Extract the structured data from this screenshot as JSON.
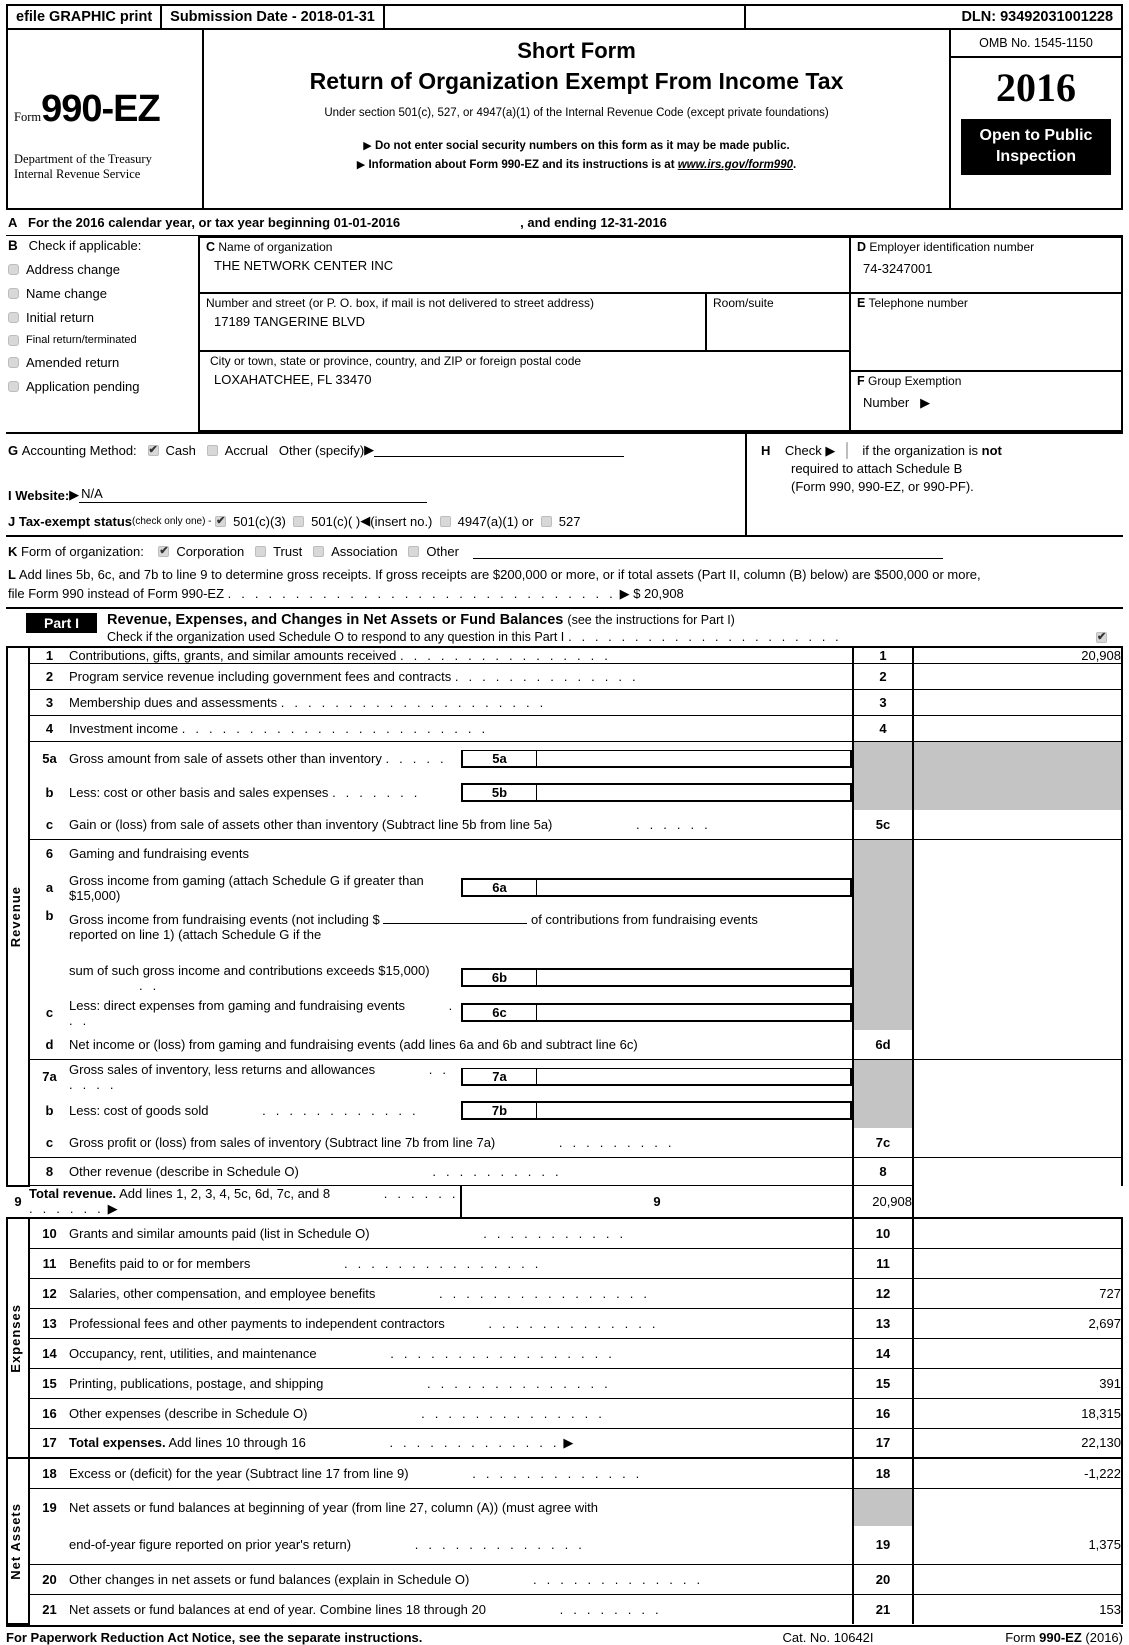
{
  "efile": {
    "graphic_print": "efile GRAPHIC print",
    "submission_date": "Submission Date - 2018-01-31",
    "dln": "DLN: 93492031001228"
  },
  "header": {
    "form_label": "Form",
    "form_number": "990-EZ",
    "dept_line1": "Department of the Treasury",
    "dept_line2": "Internal Revenue Service",
    "short_form": "Short Form",
    "title": "Return of Organization Exempt From Income Tax",
    "subtitle": "Under section 501(c), 527, or 4947(a)(1) of the Internal Revenue Code (except private foundations)",
    "bullet1": "Do not enter social security numbers on this form as it may be made public.",
    "bullet2_pre": "Information about Form 990-EZ and its instructions is at ",
    "bullet2_link": "www.irs.gov/form990",
    "bullet2_post": ".",
    "omb": "OMB No. 1545-1150",
    "year": "2016",
    "open_public": "Open to Public",
    "inspection": "Inspection"
  },
  "section_a": {
    "letter": "A",
    "text_pre": "For the 2016 calendar year, or tax year beginning",
    "begin_date": "01-01-2016",
    "text_mid": ", and ending",
    "end_date": "12-31-2016"
  },
  "section_b": {
    "letter": "B",
    "heading": "Check if applicable:",
    "items": [
      {
        "label": "Address change",
        "checked": false
      },
      {
        "label": "Name change",
        "checked": false
      },
      {
        "label": "Initial return",
        "checked": false
      },
      {
        "label": "Final return/terminated",
        "checked": false
      },
      {
        "label": "Amended return",
        "checked": false
      },
      {
        "label": "Application pending",
        "checked": false
      }
    ]
  },
  "org": {
    "c_letter": "C",
    "c_label": "Name of organization",
    "c_value": "THE NETWORK CENTER INC",
    "street_label": "Number and street (or P. O. box, if mail is not delivered to street address)",
    "street_value": "17189 TANGERINE BLVD",
    "room_label": "Room/suite",
    "room_value": "",
    "city_label": "City or town, state or province, country, and ZIP or foreign postal code",
    "city_value": "LOXAHATCHEE, FL   33470"
  },
  "right_col": {
    "d_letter": "D",
    "d_label": "Employer identification number",
    "d_value": "74-3247001",
    "e_letter": "E",
    "e_label": "Telephone number",
    "e_value": "",
    "f_letter": "F",
    "f_label": "Group Exemption",
    "f_label2": "Number",
    "f_value": ""
  },
  "section_g": {
    "letter": "G",
    "label": "Accounting Method:",
    "cash": "Cash",
    "cash_checked": true,
    "accrual": "Accrual",
    "accrual_checked": false,
    "other": "Other (specify)",
    "other_value": ""
  },
  "section_h": {
    "letter": "H",
    "text1": "Check",
    "checked": false,
    "text2_pre": "if the organization is ",
    "text2_bold": "not",
    "text3": "required to attach Schedule B",
    "text4": "(Form 990, 990-EZ, or 990-PF)."
  },
  "section_i": {
    "letter": "I Website:",
    "value": "N/A"
  },
  "section_j": {
    "letter": "J Tax-exempt status",
    "note": "(check only one) -",
    "opt1": "501(c)(3)",
    "opt1_checked": true,
    "opt2": "501(c)(   )",
    "opt2_checked": false,
    "insert": "(insert no.)",
    "opt3": "4947(a)(1) or",
    "opt3_checked": false,
    "opt4": "527",
    "opt4_checked": false
  },
  "section_k": {
    "letter": "K",
    "label": "Form of organization:",
    "opts": [
      {
        "label": "Corporation",
        "checked": true
      },
      {
        "label": "Trust",
        "checked": false
      },
      {
        "label": "Association",
        "checked": false
      },
      {
        "label": "Other",
        "checked": false
      }
    ],
    "other_value": ""
  },
  "section_l": {
    "letter": "L",
    "line1": "Add lines 5b, 6c, and 7b to line 9 to determine gross receipts. If gross receipts are $200,000 or more, or if total assets (Part II, column (B) below) are $500,000 or more,",
    "line2": "file Form 990 instead of Form 990-EZ",
    "amount": "$ 20,908"
  },
  "part1": {
    "tag": "Part I",
    "title": "Revenue, Expenses, and Changes in Net Assets or Fund Balances",
    "title_note": "(see the instructions for Part I)",
    "schedule_o_text": "Check if the organization used Schedule O to respond to any question in this Part I",
    "schedule_o_checked": true,
    "side_labels": {
      "revenue": "Revenue",
      "expenses": "Expenses",
      "net_assets": "Net Assets"
    },
    "rows": [
      {
        "num": "1",
        "desc": "Contributions, gifts, grants, and similar amounts received",
        "box": "1",
        "amount": "20,908"
      },
      {
        "num": "2",
        "desc": "Program service revenue including government fees and contracts",
        "box": "2",
        "amount": ""
      },
      {
        "num": "3",
        "desc": "Membership dues and assessments",
        "box": "3",
        "amount": ""
      },
      {
        "num": "4",
        "desc": "Investment income",
        "box": "4",
        "amount": ""
      },
      {
        "num": "5a",
        "desc": "Gross amount from sale of assets other than inventory",
        "sub": "5a",
        "sub_amount": ""
      },
      {
        "num": "b",
        "desc": "Less: cost or other basis and sales expenses",
        "sub": "5b",
        "sub_amount": ""
      },
      {
        "num": "c",
        "desc": "Gain or (loss) from sale of assets other than inventory (Subtract line 5b from line 5a)",
        "box": "5c",
        "amount": ""
      },
      {
        "num": "6",
        "desc": "Gaming and fundraising events"
      },
      {
        "num": "a",
        "desc": "Gross income from gaming (attach Schedule G if greater than $15,000)",
        "sub": "6a",
        "sub_amount": ""
      },
      {
        "num": "b",
        "desc": "Gross income from fundraising events (not including $",
        "desc2": "of contributions from fundraising events",
        "desc3": "reported on line 1) (attach Schedule G if the",
        "inline_value": ""
      },
      {
        "num": "",
        "desc": "sum of such gross income and contributions exceeds $15,000)",
        "sub": "6b",
        "sub_amount": ""
      },
      {
        "num": "c",
        "desc": "Less: direct expenses from gaming and fundraising events",
        "sub": "6c",
        "sub_amount": ""
      },
      {
        "num": "d",
        "desc": "Net income or (loss) from gaming and fundraising events (add lines 6a and 6b and subtract line 6c)",
        "box": "6d",
        "amount": ""
      },
      {
        "num": "7a",
        "desc": "Gross sales of inventory, less returns and allowances",
        "sub": "7a",
        "sub_amount": ""
      },
      {
        "num": "b",
        "desc": "Less: cost of goods sold",
        "sub": "7b",
        "sub_amount": ""
      },
      {
        "num": "c",
        "desc": "Gross profit or (loss) from sales of inventory (Subtract line 7b from line 7a)",
        "box": "7c",
        "amount": ""
      },
      {
        "num": "8",
        "desc": "Other revenue (describe in Schedule O)",
        "box": "8",
        "amount": ""
      },
      {
        "num": "9",
        "desc_bold": "Total revenue.",
        "desc": " Add lines 1, 2, 3, 4, 5c, 6d, 7c, and 8",
        "box": "9",
        "amount": "20,908"
      },
      {
        "num": "10",
        "desc": "Grants and similar amounts paid (list in Schedule O)",
        "box": "10",
        "amount": ""
      },
      {
        "num": "11",
        "desc": "Benefits paid to or for members",
        "box": "11",
        "amount": ""
      },
      {
        "num": "12",
        "desc": "Salaries, other compensation, and employee benefits",
        "box": "12",
        "amount": "727"
      },
      {
        "num": "13",
        "desc": "Professional fees and other payments to independent contractors",
        "box": "13",
        "amount": "2,697"
      },
      {
        "num": "14",
        "desc": "Occupancy, rent, utilities, and maintenance",
        "box": "14",
        "amount": ""
      },
      {
        "num": "15",
        "desc": "Printing, publications, postage, and shipping",
        "box": "15",
        "amount": "391"
      },
      {
        "num": "16",
        "desc": "Other expenses (describe in Schedule O)",
        "box": "16",
        "amount": "18,315"
      },
      {
        "num": "17",
        "desc_bold": "Total expenses.",
        "desc": " Add lines 10 through 16",
        "box": "17",
        "amount": "22,130"
      },
      {
        "num": "18",
        "desc": "Excess or (deficit) for the year (Subtract line 17 from line 9)",
        "box": "18",
        "amount": "-1,222"
      },
      {
        "num": "19",
        "desc": "Net assets or fund balances at beginning of year (from line 27, column (A)) (must agree with"
      },
      {
        "num": "",
        "desc": "end-of-year figure reported on prior year's return)",
        "box": "19",
        "amount": "1,375"
      },
      {
        "num": "20",
        "desc": "Other changes in net assets or fund balances (explain in Schedule O)",
        "box": "20",
        "amount": ""
      },
      {
        "num": "21",
        "desc": "Net assets or fund balances at end of year. Combine lines 18 through 20",
        "box": "21",
        "amount": "153"
      }
    ]
  },
  "footer": {
    "notice_bold1": "For Paperwork Reduction Act Notice,",
    "notice_rest": " see the separate instructions.",
    "cat": "Cat. No. 10642I",
    "form_pre": "Form ",
    "form_bold": "990-EZ",
    "form_year": " (2016)"
  }
}
